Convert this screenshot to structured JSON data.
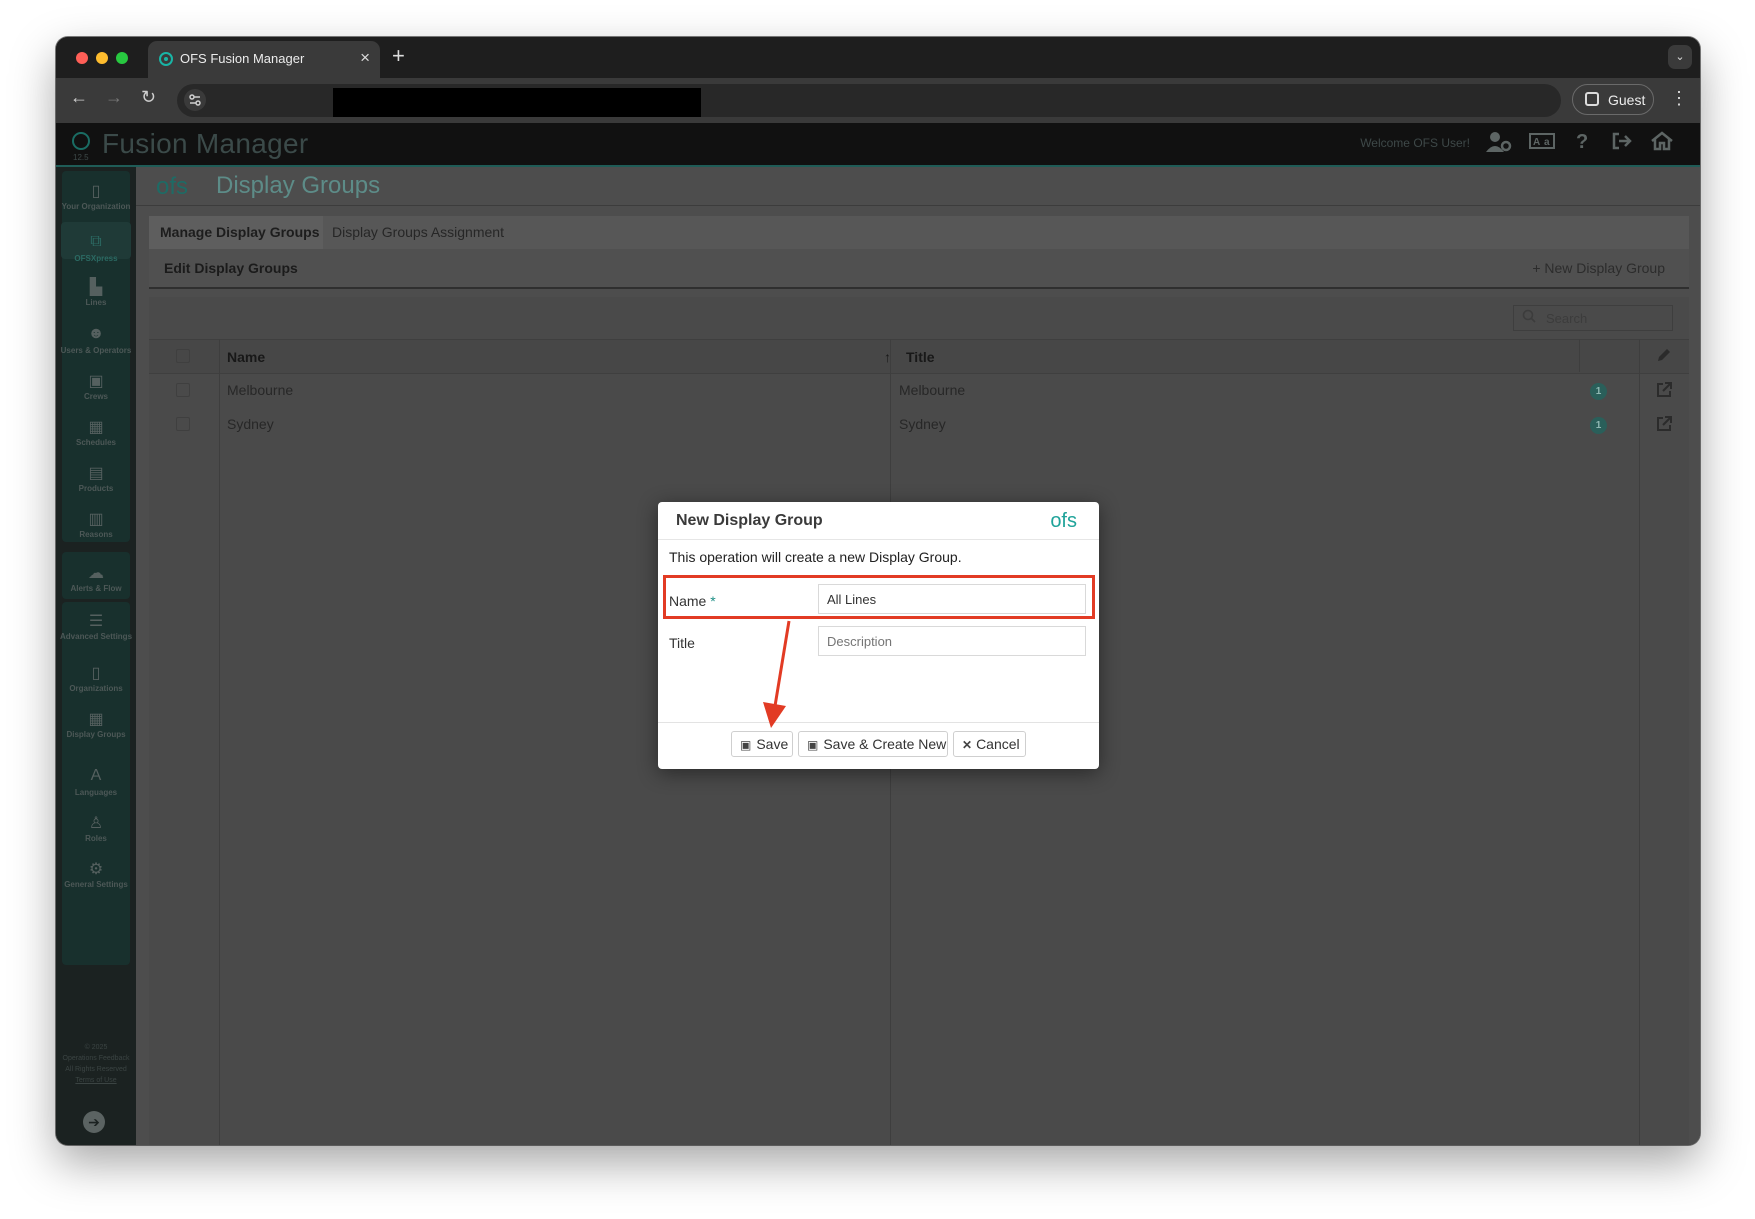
{
  "browser": {
    "tab_title": "OFS Fusion Manager",
    "tab_close": "×",
    "new_tab": "+",
    "tabs_dropdown": "⌄",
    "profile_label": "Guest",
    "kebab": "⋮",
    "nav": {
      "back": "←",
      "forward": "→",
      "reload": "↻"
    }
  },
  "header": {
    "app_name": "Fusion Manager",
    "version": "12.5",
    "welcome": "Welcome OFS User!",
    "icons": [
      "user-settings-icon",
      "language-icon",
      "help-icon",
      "logout-icon",
      "home-icon"
    ]
  },
  "sidebar": {
    "items": [
      {
        "label": "Your Organization",
        "icon": "▯"
      },
      {
        "label": "OFSXpress",
        "icon": "⧉"
      },
      {
        "label": "Lines",
        "icon": "▙"
      },
      {
        "label": "Users & Operators",
        "icon": "☻"
      },
      {
        "label": "Crews",
        "icon": "▣"
      },
      {
        "label": "Schedules",
        "icon": "▦"
      },
      {
        "label": "Products",
        "icon": "▤"
      },
      {
        "label": "Reasons",
        "icon": "▥"
      },
      {
        "label": "Alerts & Flow",
        "icon": "☁"
      },
      {
        "label": "Advanced Settings",
        "icon": "☰"
      },
      {
        "label": "Organizations",
        "icon": "▯"
      },
      {
        "label": "Display Groups",
        "icon": "▦"
      },
      {
        "label": "Languages",
        "icon": "A"
      },
      {
        "label": "Roles",
        "icon": "♙"
      },
      {
        "label": "General Settings",
        "icon": "⚙"
      }
    ],
    "footer": [
      "© 2025",
      "Operations Feedback",
      "All Rights Reserved",
      "Terms of Use"
    ],
    "toggle": "➔"
  },
  "page": {
    "logo_text": "ofs",
    "title": "Display Groups",
    "tabs": [
      "Manage Display Groups",
      "Display Groups Assignment"
    ],
    "section_title": "Edit Display Groups",
    "new_button": "+ New Display Group",
    "search_placeholder": "Search"
  },
  "grid": {
    "columns": [
      "Name",
      "Title"
    ],
    "sort_indicator": "↑",
    "rows": [
      {
        "name": "Melbourne",
        "title": "Melbourne",
        "count": "1"
      },
      {
        "name": "Sydney",
        "title": "Sydney",
        "count": "1"
      }
    ]
  },
  "modal": {
    "title": "New Display Group",
    "logo_text": "ofs",
    "description": "This operation will create a new Display Group.",
    "name_label": "Name",
    "required_marker": "*",
    "name_value": "All Lines",
    "title_label": "Title",
    "title_placeholder": "Description",
    "buttons": {
      "save": "Save",
      "save_new": "Save & Create New",
      "cancel": "Cancel"
    }
  },
  "annotation_color": "#e23b24"
}
